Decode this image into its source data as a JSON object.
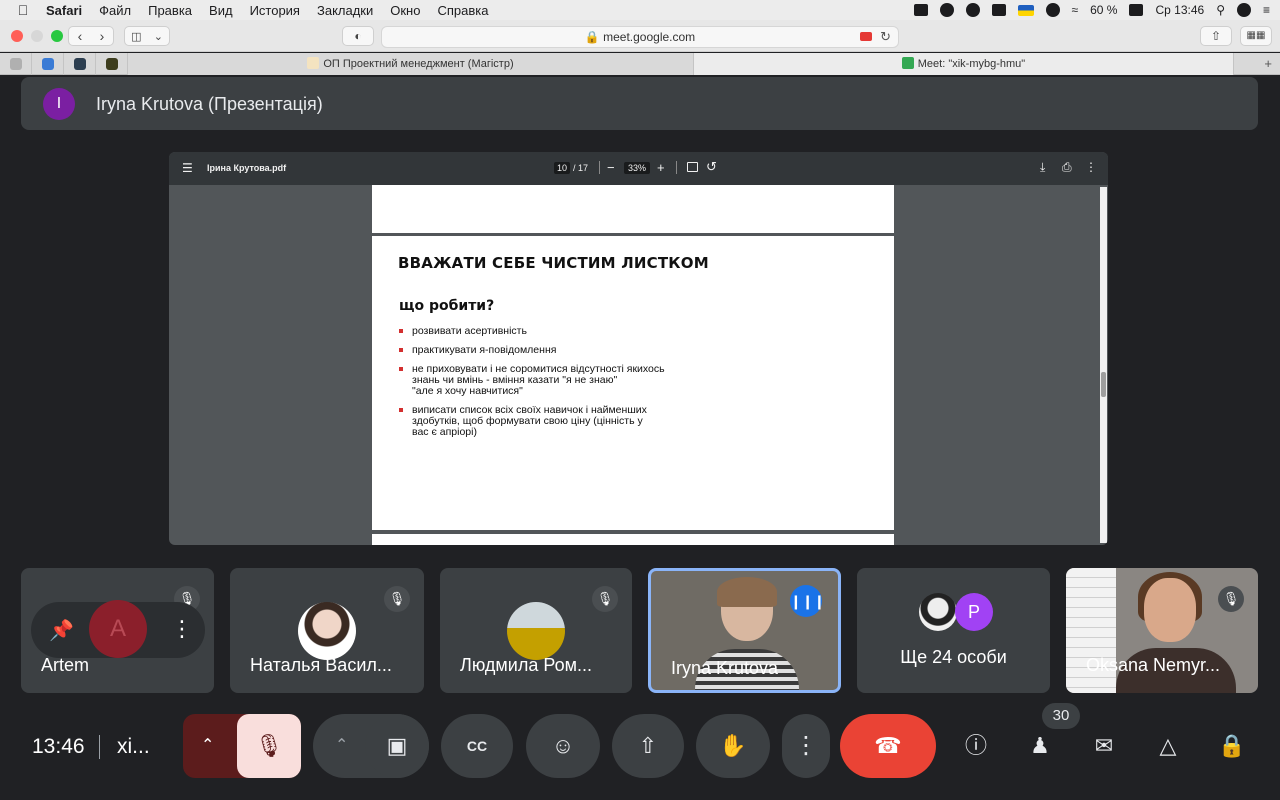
{
  "menubar": {
    "apple": "",
    "items": [
      "Safari",
      "Файл",
      "Правка",
      "Вид",
      "История",
      "Закладки",
      "Окно",
      "Справка"
    ],
    "battery": "60 %",
    "clock": "Ср 13:46"
  },
  "browser": {
    "url": "meet.google.com",
    "tabs": [
      {
        "title": "ОП Проектний менеджмент (Магістр)"
      },
      {
        "title": "Meet: \"xik-mybg-hmu\""
      }
    ]
  },
  "presenter": {
    "initial": "I",
    "label": "Iryna Krutova (Презентація)",
    "color": "#7b1fa2"
  },
  "pdf": {
    "filename": "Ірина Крутова.pdf",
    "page_current": "10",
    "page_total": "/ 17",
    "zoom": "33%",
    "zoom_out": "−",
    "zoom_in": "+",
    "slide": {
      "title": "ВВАЖАТИ СЕБЕ ЧИСТИМ ЛИСТКОМ",
      "subtitle": "що робити?",
      "bullets": [
        "розвивати асертивність",
        "практикувати я-повідомлення",
        "не приховувати і не соромитися відсутності якихось\nзнань чи вмінь - вміння казати \"я не знаю\"\n\"але я хочу навчитися\"",
        "виписати список всіх своїх навичок і найменших\nздобутків, щоб формувати свою ціну (цінність у\nвас є апріорі)"
      ],
      "bullet_color": "#d32f2f"
    }
  },
  "participants": [
    {
      "name": "Artem",
      "initial": "A"
    },
    {
      "name": "Наталья Васил..."
    },
    {
      "name": "Людмила Ром..."
    },
    {
      "name": "Iryna Krutova"
    },
    {
      "name": "Ще 24 особи",
      "extra_initial": "P"
    },
    {
      "name": "Oksana Nemyr..."
    }
  ],
  "controls": {
    "time": "13:46",
    "meeting_code": "xi...",
    "people_count": "30",
    "cc_label": "CC",
    "accent_end_call": "#ea4335",
    "accent_speaking": "#1a73e8"
  },
  "icons": [
    "pin-icon",
    "more-vert-icon",
    "mic-off-icon",
    "camera-icon",
    "captions-icon",
    "emoji-icon",
    "present-icon",
    "raise-hand-icon",
    "end-call-icon",
    "info-icon",
    "people-icon",
    "chat-icon",
    "activities-icon",
    "host-controls-icon"
  ]
}
